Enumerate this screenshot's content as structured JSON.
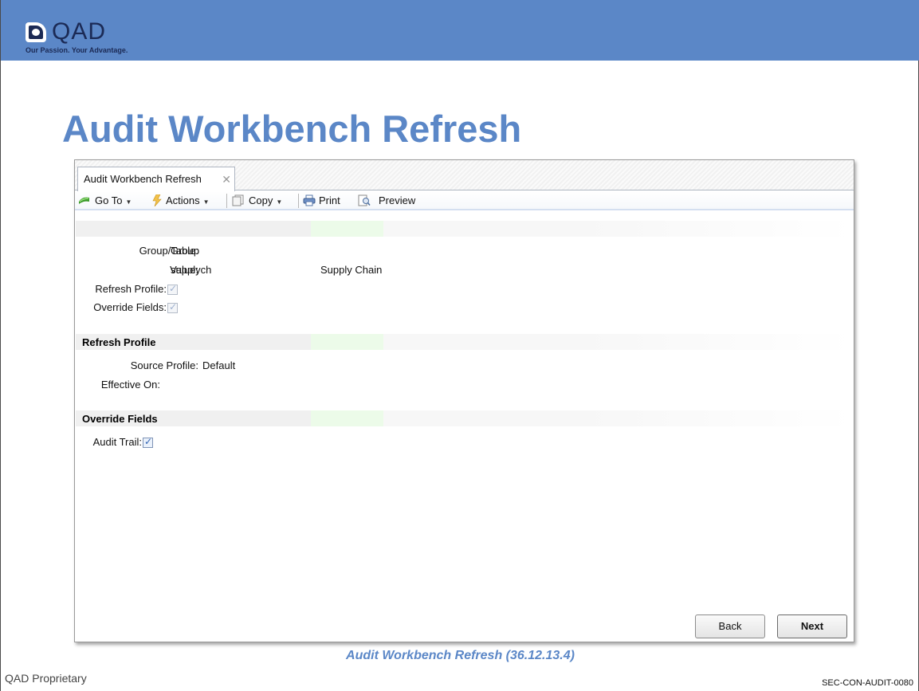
{
  "brand": {
    "logo_text": "QAD",
    "tagline": "Our Passion. Your Advantage."
  },
  "slide_title": "Audit Workbench Refresh",
  "window": {
    "tab_label": "Audit Workbench Refresh",
    "tab_close": "✕",
    "toolbar": {
      "goto_label": "Go To",
      "actions_label": "Actions",
      "copy_label": "Copy",
      "print_label": "Print",
      "preview_label": "Preview"
    },
    "fields": {
      "group_table_label": "Group/Table:",
      "group_table_value": "Group",
      "value_label": "Value:",
      "value_value": "supplych",
      "value_description": "Supply Chain",
      "refresh_profile_label": "Refresh Profile:",
      "refresh_profile_checked": true,
      "override_fields_label": "Override Fields:",
      "override_fields_checked": true
    },
    "refresh_profile_section": {
      "title": "Refresh Profile",
      "source_profile_label": "Source Profile:",
      "source_profile_value": "Default",
      "effective_on_label": "Effective On:",
      "effective_on_value": ""
    },
    "override_fields_section": {
      "title": "Override Fields",
      "audit_trail_label": "Audit Trail:",
      "audit_trail_checked": true
    },
    "buttons": {
      "back_label": "Back",
      "next_label": "Next"
    }
  },
  "caption": "Audit Workbench Refresh (36.12.13.4)",
  "footer": {
    "left": "QAD Proprietary",
    "right": "SEC-CON-AUDIT-0080"
  },
  "colors": {
    "banner": "#5b87c7",
    "title": "#5b87c7",
    "logo_navy": "#1b2a55"
  }
}
